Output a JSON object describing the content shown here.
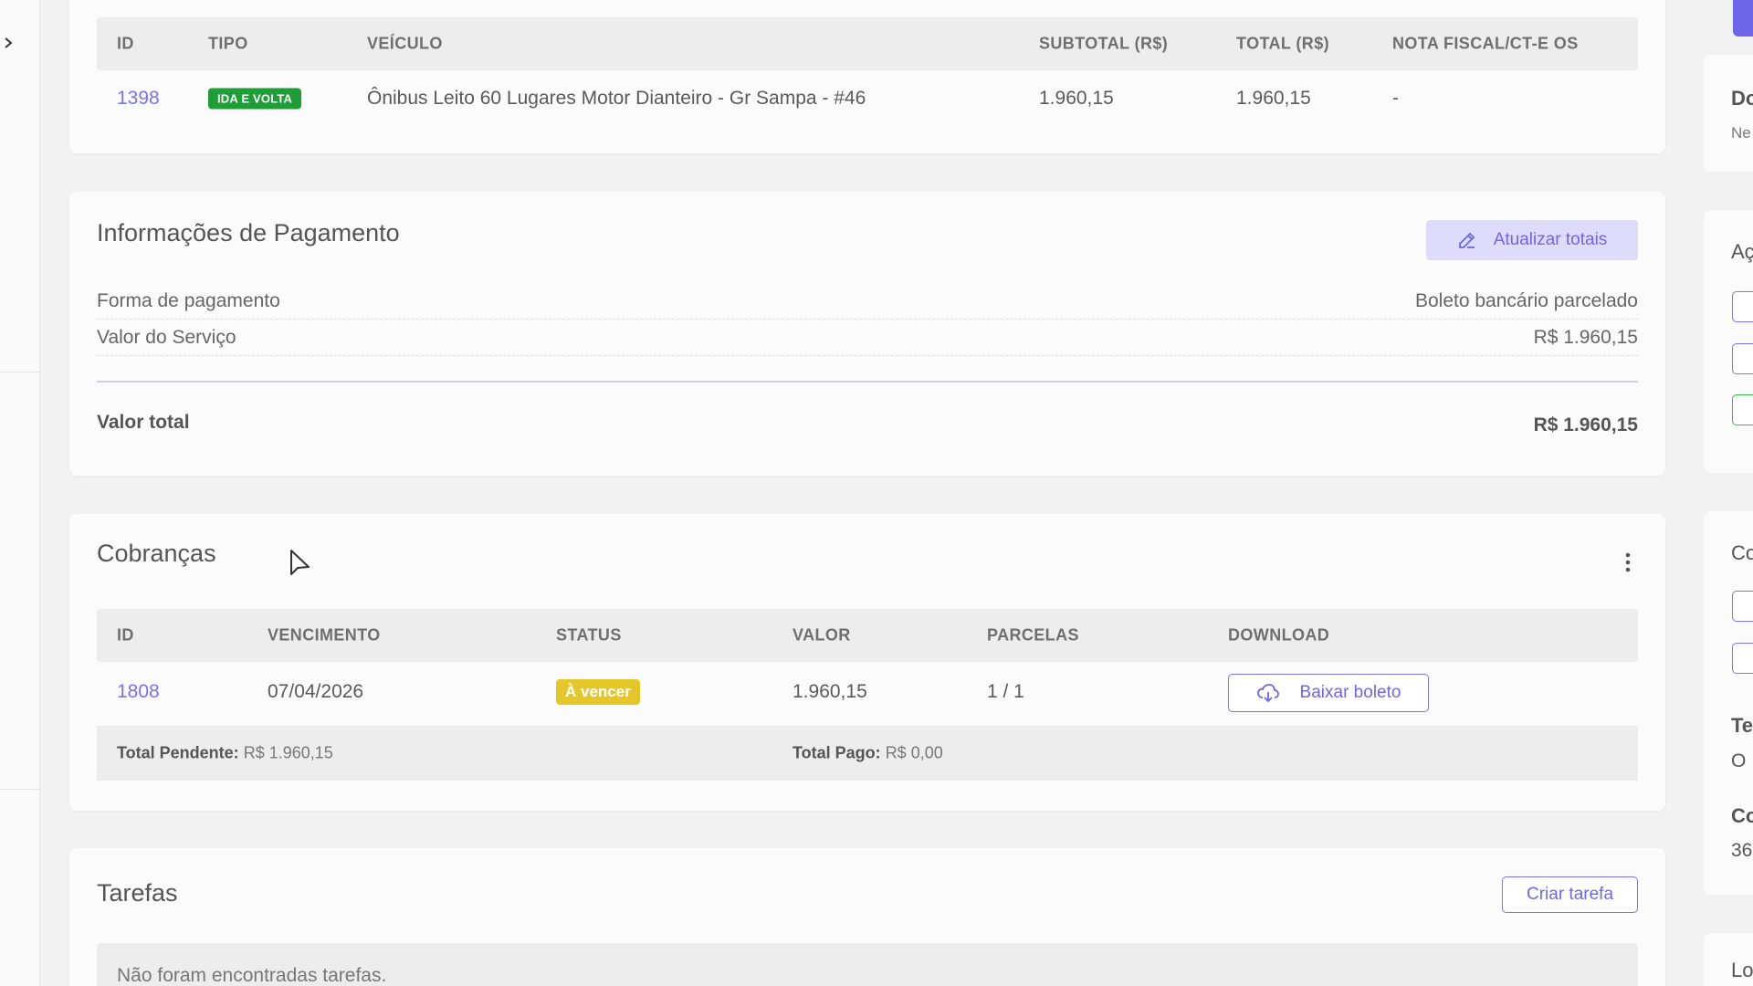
{
  "vehicles_table": {
    "headers": [
      "ID",
      "TIPO",
      "VEÍCULO",
      "SUBTOTAL (R$)",
      "TOTAL (R$)",
      "NOTA FISCAL/CT-E OS"
    ],
    "rows": [
      {
        "id": "1398",
        "tipo": "IDA E VOLTA",
        "veiculo": "Ônibus Leito 60 Lugares Motor Dianteiro - Gr Sampa - #46",
        "subtotal": "1.960,15",
        "total": "1.960,15",
        "nota": "-"
      }
    ]
  },
  "payment": {
    "title": "Informações de Pagamento",
    "update_button": "Atualizar totais",
    "rows": [
      {
        "label": "Forma de pagamento",
        "value": "Boleto bancário parcelado"
      },
      {
        "label": "Valor do Serviço",
        "value": "R$ 1.960,15"
      }
    ],
    "total_label": "Valor total",
    "total_value": "R$ 1.960,15"
  },
  "charges": {
    "title": "Cobranças",
    "headers": [
      "ID",
      "VENCIMENTO",
      "STATUS",
      "VALOR",
      "PARCELAS",
      "DOWNLOAD"
    ],
    "rows": [
      {
        "id": "1808",
        "vencimento": "07/04/2026",
        "status": "À vencer",
        "valor": "1.960,15",
        "parcelas": "1 / 1",
        "download": "Baixar boleto"
      }
    ],
    "pending_label": "Total Pendente:",
    "pending_value": "R$ 1.960,15",
    "paid_label": "Total Pago:",
    "paid_value": "R$ 0,00"
  },
  "tasks": {
    "title": "Tarefas",
    "create_button": "Criar tarefa",
    "empty_text": "Não foram encontradas tarefas."
  },
  "right_panel": {
    "t1": "Do",
    "t2": "Ne",
    "t3": "Aç",
    "t4": "Co",
    "t5": "Te",
    "t6": "O",
    "t7": "Co",
    "t8": "36",
    "t9": "Lo"
  },
  "colors": {
    "accent": "#7a73ea",
    "badge_green": "#1f9d37",
    "badge_yellow": "#e6c72a"
  }
}
